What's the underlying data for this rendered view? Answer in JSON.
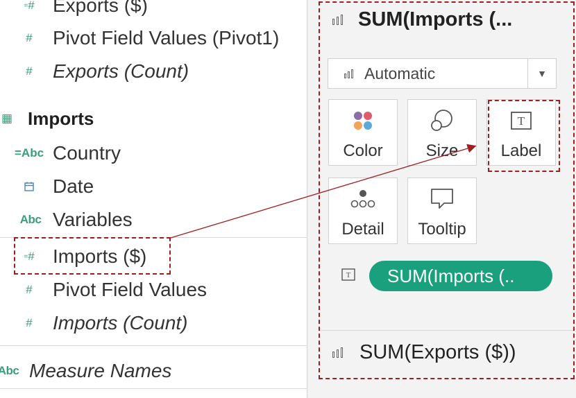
{
  "data_pane": {
    "exports_items": [
      {
        "label": "Exports ($)",
        "icon": "measure-number-icon"
      },
      {
        "label": "Pivot Field Values (Pivot1)",
        "icon": "number-icon"
      },
      {
        "label": "Exports (Count)",
        "icon": "number-icon"
      }
    ],
    "imports_table": {
      "label": "Imports",
      "icon": "table-icon"
    },
    "imports_items": [
      {
        "label": "Country",
        "icon": "geo-string-icon",
        "glyph": "=Abc"
      },
      {
        "label": "Date",
        "icon": "calendar-icon"
      },
      {
        "label": "Variables",
        "icon": "string-icon",
        "glyph": "Abc"
      },
      {
        "label": "Imports ($)",
        "icon": "measure-number-icon"
      },
      {
        "label": "Pivot Field Values",
        "icon": "number-icon"
      },
      {
        "label": "Imports (Count)",
        "icon": "number-icon"
      }
    ],
    "measure_names": {
      "label": "Measure Names",
      "glyph": "Abc"
    }
  },
  "marks_card": {
    "title": "SUM(Imports (...",
    "mark_type": "Automatic",
    "tiles": {
      "color": "Color",
      "size": "Size",
      "label": "Label",
      "detail": "Detail",
      "tooltip": "Tooltip"
    },
    "label_pill": "SUM(Imports (..",
    "second_shelf": "SUM(Exports ($))"
  },
  "colors": {
    "pill_green": "#1aa07d",
    "annotation_red": "#a01e1e",
    "number_icon_green": "#3a9e7a",
    "dimension_blue": "#4a82b0"
  }
}
